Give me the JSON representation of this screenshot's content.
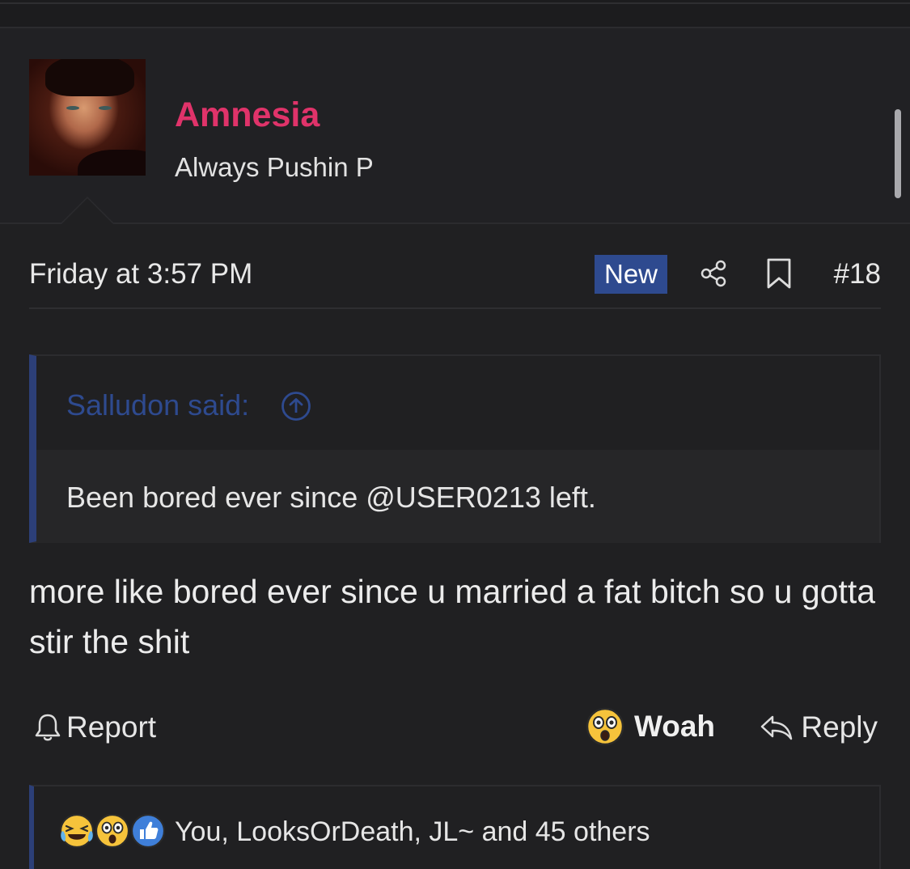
{
  "user": {
    "name": "Amnesia",
    "title": "Always Pushin P"
  },
  "post": {
    "date": "Friday at 3:57 PM",
    "badge": "New",
    "number": "#18",
    "message": "more like bored ever since u married a fat bitch so u gotta stir the shit"
  },
  "quote": {
    "attribution": "Salludon said:",
    "text": "Been bored ever since @USER0213 left."
  },
  "actions": {
    "report_label": "Report",
    "reaction_label": "Woah",
    "reply_label": "Reply"
  },
  "reactions": {
    "icons": [
      "laughing-crying-emoji",
      "astonished-emoji",
      "thumbs-up-icon"
    ],
    "summary": "You, LooksOrDeath, JL~ and 45 others"
  },
  "colors": {
    "background": "#202022",
    "username": "#e0336a",
    "accent_blue": "#2e4a8f",
    "text": "#e6e6e6"
  }
}
